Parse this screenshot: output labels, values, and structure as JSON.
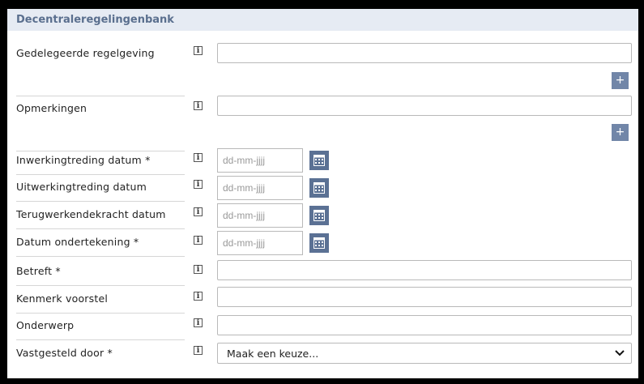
{
  "section": {
    "title": "Decentraleregelingenbank"
  },
  "info_glyph": "i",
  "add_label": "+",
  "fields": {
    "gedelegeerde": {
      "label": "Gedelegeerde regelgeving",
      "value": ""
    },
    "opmerkingen": {
      "label": "Opmerkingen",
      "value": ""
    },
    "inwerking": {
      "label": "Inwerkingtreding datum *",
      "placeholder": "dd-mm-jjjj"
    },
    "uitwerking": {
      "label": "Uitwerkingtreding datum",
      "placeholder": "dd-mm-jjjj"
    },
    "terugwerkend": {
      "label": "Terugwerkendekracht datum",
      "placeholder": "dd-mm-jjjj"
    },
    "ondertekening": {
      "label": "Datum ondertekening *",
      "placeholder": "dd-mm-jjjj"
    },
    "betreft": {
      "label": "Betreft *",
      "value": ""
    },
    "kenmerk": {
      "label": "Kenmerk voorstel",
      "value": ""
    },
    "onderwerp": {
      "label": "Onderwerp",
      "value": ""
    },
    "vastgesteld": {
      "label": "Vastgesteld door *",
      "selected": "Maak een keuze..."
    }
  },
  "icons": {
    "info": "info-icon",
    "calendar": "calendar-icon",
    "add": "plus-icon",
    "dropdown": "chevron-down-icon"
  },
  "colors": {
    "header_bg": "#e6ebf3",
    "header_text": "#5a6f8e",
    "button_bg": "#5b7194",
    "plus_bg": "#7186a8"
  }
}
